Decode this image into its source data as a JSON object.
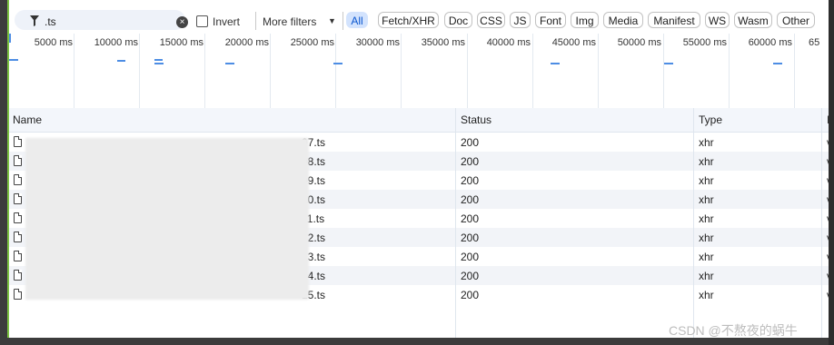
{
  "toolbar": {
    "filter_value": ".ts",
    "invert_label": "Invert",
    "more_filters_label": "More filters",
    "chips": [
      "All",
      "Fetch/XHR",
      "Doc",
      "CSS",
      "JS",
      "Font",
      "Img",
      "Media",
      "Manifest",
      "WS",
      "Wasm",
      "Other"
    ],
    "active_chip": "All"
  },
  "timeline": {
    "ticks": [
      "5000 ms",
      "10000 ms",
      "15000 ms",
      "20000 ms",
      "25000 ms",
      "30000 ms",
      "35000 ms",
      "40000 ms",
      "45000 ms",
      "50000 ms",
      "55000 ms",
      "60000 ms",
      "65"
    ]
  },
  "table": {
    "columns": [
      "Name",
      "Status",
      "Type",
      "I"
    ],
    "rows": [
      {
        "name": "07.ts",
        "status": "200",
        "type": "xhr",
        "extra": "v"
      },
      {
        "name": "08.ts",
        "status": "200",
        "type": "xhr",
        "extra": "v"
      },
      {
        "name": "09.ts",
        "status": "200",
        "type": "xhr",
        "extra": "v"
      },
      {
        "name": "10.ts",
        "status": "200",
        "type": "xhr",
        "extra": "v"
      },
      {
        "name": "11.ts",
        "status": "200",
        "type": "xhr",
        "extra": "v"
      },
      {
        "name": "12.ts",
        "status": "200",
        "type": "xhr",
        "extra": "v"
      },
      {
        "name": "13.ts",
        "status": "200",
        "type": "xhr",
        "extra": "v"
      },
      {
        "name": "14.ts",
        "status": "200",
        "type": "xhr",
        "extra": "v"
      },
      {
        "name": "15.ts",
        "status": "200",
        "type": "xhr",
        "extra": "v"
      }
    ]
  },
  "watermark": "CSDN @不熬夜的蜗牛",
  "colors": {
    "accent": "#0b57d0",
    "chip_active_bg": "#d3e3fd",
    "waterfall_blip": "#4d8de4",
    "left_bar": "#7cc242"
  }
}
